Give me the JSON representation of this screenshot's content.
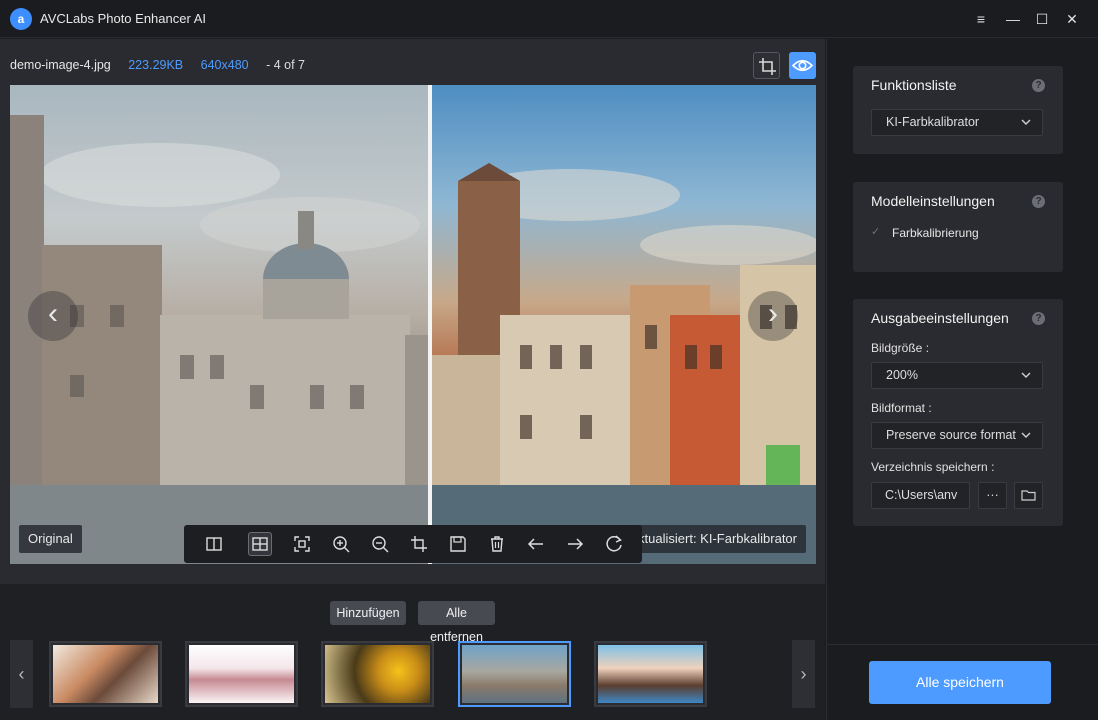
{
  "app": {
    "title": "AVCLabs Photo Enhancer AI",
    "logo_letter": "a"
  },
  "window_controls": {
    "menu": "≡",
    "minimize": "—",
    "maximize": "☐",
    "close": "✕"
  },
  "file_info": {
    "name": "demo-image-4.jpg",
    "size": "223.29KB",
    "dimensions": "640x480",
    "position": "- 4 of 7"
  },
  "preview": {
    "left_label": "Original",
    "right_label": "ktualisiert: KI-Farbkalibrator",
    "prev_arrow": "‹",
    "next_arrow": "›"
  },
  "bottom": {
    "add_label": "Hinzufügen",
    "remove_all_label": "Alle entfernen",
    "thumb_prev": "‹",
    "thumb_next": "›"
  },
  "sidebar": {
    "function_list": {
      "title": "Funktionsliste",
      "help": "?",
      "selected": "KI-Farbkalibrator"
    },
    "model_settings": {
      "title": "Modelleinstellungen",
      "help": "?",
      "option": "Farbkalibrierung",
      "check": "✓"
    },
    "output_settings": {
      "title": "Ausgabeeinstellungen",
      "help": "?",
      "size_label": "Bildgröße :",
      "size_value": "200%",
      "format_label": "Bildformat :",
      "format_value": "Preserve source format",
      "dir_label": "Verzeichnis speichern :",
      "dir_value": "C:\\Users\\anv",
      "dots": "···"
    },
    "save_all": "Alle speichern"
  },
  "colors": {
    "accent": "#4d9bff",
    "panel": "#2a2b30",
    "background": "#1b1c20"
  }
}
